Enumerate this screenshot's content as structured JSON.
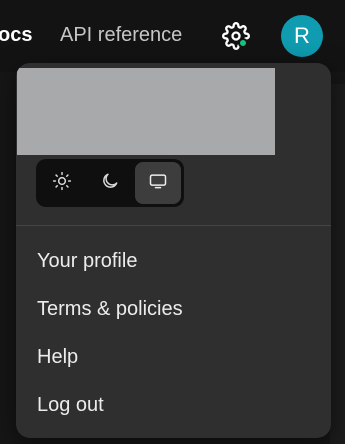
{
  "nav": {
    "docs_label": "ocs",
    "api_reference_label": "API reference"
  },
  "header": {
    "settings_icon": "gear-icon",
    "status_dot_color": "#19c37d",
    "avatar_initial": "R",
    "avatar_color": "#0f9bb0"
  },
  "menu": {
    "theme_options": [
      {
        "icon": "sun-icon",
        "selected": false
      },
      {
        "icon": "moon-icon",
        "selected": false
      },
      {
        "icon": "monitor-icon",
        "selected": true
      }
    ],
    "items": [
      {
        "label": "Your profile"
      },
      {
        "label": "Terms & policies"
      },
      {
        "label": "Help"
      },
      {
        "label": "Log out"
      }
    ]
  }
}
